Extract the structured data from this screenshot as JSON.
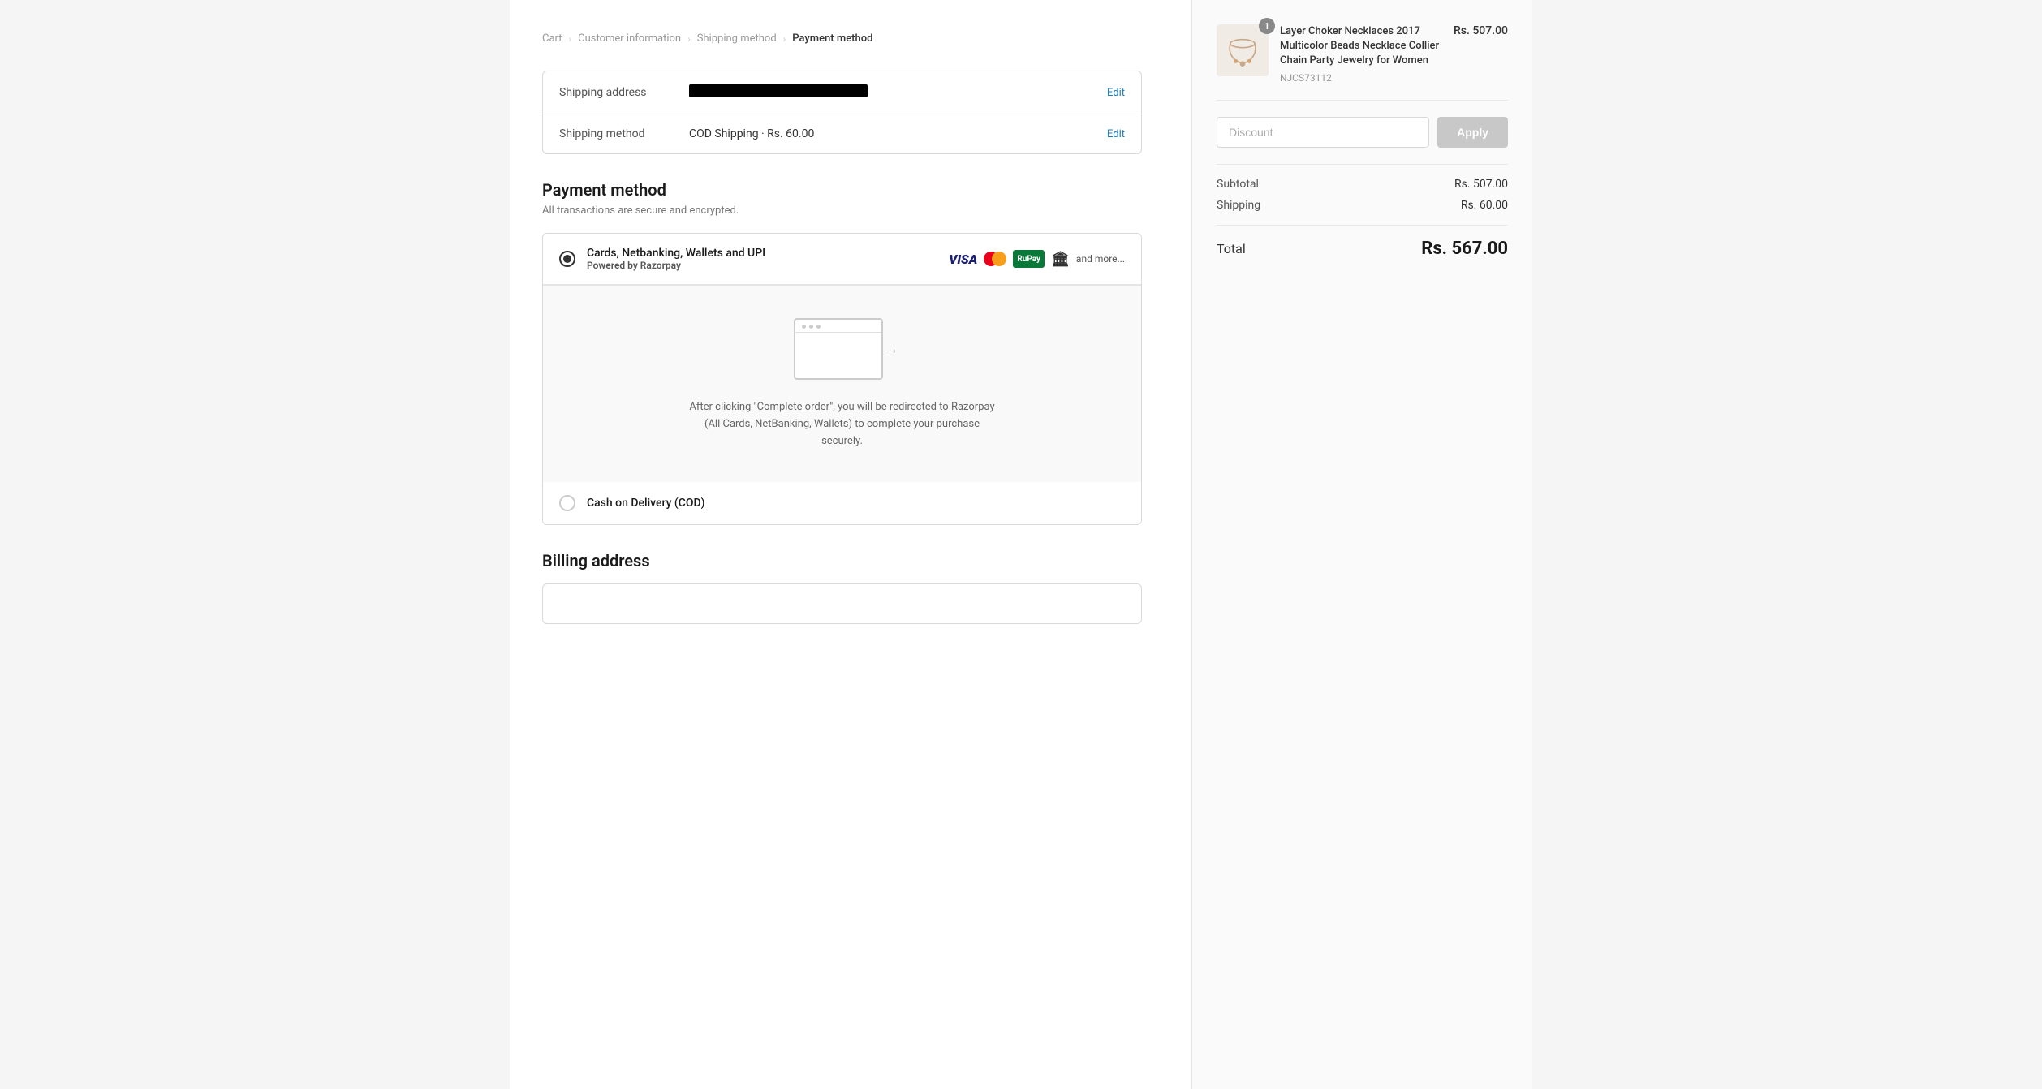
{
  "breadcrumb": {
    "items": [
      {
        "label": "Cart",
        "active": false
      },
      {
        "label": "Customer information",
        "active": false
      },
      {
        "label": "Shipping method",
        "active": false
      },
      {
        "label": "Payment method",
        "active": true
      }
    ]
  },
  "shipping_summary": {
    "address_label": "Shipping address",
    "address_value_redacted": true,
    "address_edit": "Edit",
    "method_label": "Shipping method",
    "method_value": "COD Shipping · Rs. 60.00",
    "method_edit": "Edit"
  },
  "payment_method": {
    "title": "Payment method",
    "subtitle": "All transactions are secure and encrypted.",
    "options": [
      {
        "id": "razorpay",
        "label": "Cards, Netbanking, Wallets and UPI",
        "sublabel_prefix": "Powered by",
        "sublabel_brand": "Razorpay",
        "selected": true,
        "show_icons": true
      },
      {
        "id": "cod",
        "label": "Cash on Delivery (COD)",
        "sublabel_prefix": "",
        "sublabel_brand": "",
        "selected": false,
        "show_icons": false
      }
    ],
    "razorpay_redirect_text": "After clicking \"Complete order\", you will be redirected to Razorpay (All Cards, NetBanking, Wallets) to complete your purchase securely.",
    "icons": {
      "and_more": "and more..."
    }
  },
  "billing_address": {
    "title": "Billing address"
  },
  "order_summary": {
    "item": {
      "name": "Layer Choker Necklaces 2017 Multicolor Beads Necklace Collier Chain Party Jewelry for Women",
      "sku": "NJCS73112",
      "price": "Rs. 507.00",
      "qty": 1
    },
    "discount": {
      "placeholder": "Discount",
      "apply_label": "Apply"
    },
    "subtotal_label": "Subtotal",
    "subtotal_value": "Rs. 507.00",
    "shipping_label": "Shipping",
    "shipping_value": "Rs. 60.00",
    "total_label": "Total",
    "total_value": "Rs. 567.00"
  }
}
